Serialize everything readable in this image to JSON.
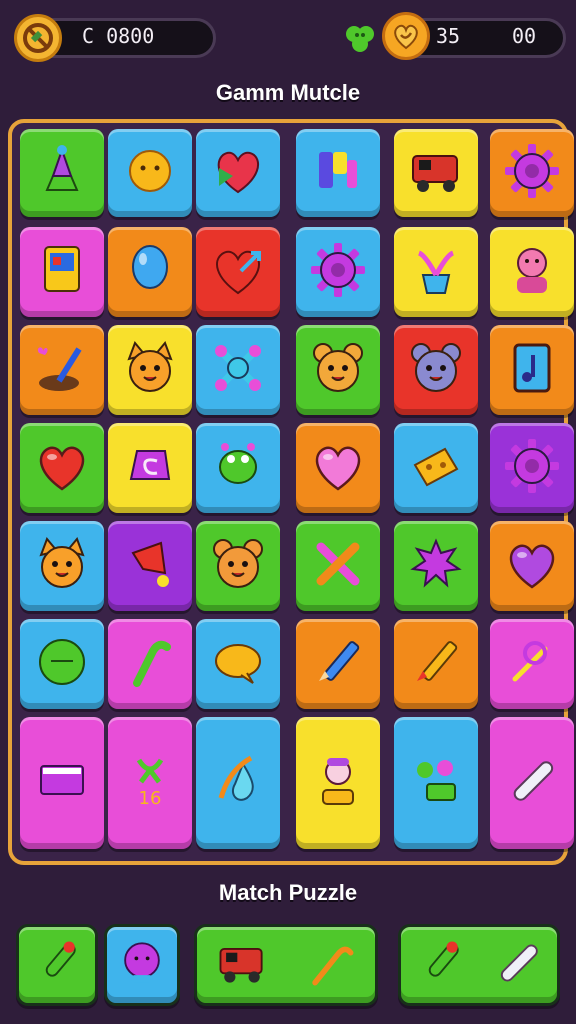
{
  "hud": {
    "score": "C 0800",
    "lives": "35",
    "timer": "00",
    "coin_icon": "no-coin-icon",
    "clover_icon": "clover-icon",
    "heart_icon": "heart-ring-icon"
  },
  "titles": {
    "top": "Gamm Mutcle",
    "bottom": "Match Puzzle"
  },
  "colors": {
    "green": "#4fc82b",
    "blue": "#3fb4ec",
    "yellow": "#f8e02c",
    "orange": "#f28a1a",
    "red": "#e8342a",
    "pink": "#e84ed8",
    "purple": "#9a32d8",
    "frame": "#e7a33a",
    "background": "#2f1d3a"
  },
  "board": {
    "rows": [
      [
        "green:gnome-icon",
        "blue:sun-icon",
        "blue:heart-gem-icon",
        "blue:letter-block-icon",
        "yellow:toy-truck-icon",
        "orange:gear-icon"
      ],
      [
        "pink:arcade-machine-icon",
        "orange:balloon-icon",
        "red:heart-arrow-icon",
        "blue:gear-icon",
        "yellow:flower-pot-icon",
        "yellow:pink-doll-icon"
      ],
      [
        "orange:paintbrush-icon",
        "yellow:cat-face-icon",
        "blue:bone-cross-icon",
        "green:bear-face-icon",
        "red:mouse-face-icon",
        "orange:music-card-icon"
      ],
      [
        "green:heart-icon",
        "yellow:candy-swirl-icon",
        "blue:frog-icon",
        "orange:pink-heart-icon",
        "blue:cheese-icon",
        "purple:gear-icon"
      ],
      [
        "blue:cat-face-icon",
        "purple:megaphone-icon",
        "green:teddy-bear-icon",
        "green:cross-sticks-icon",
        "green:splat-icon",
        "orange:purple-heart-icon"
      ],
      [
        "blue:green-ball-icon",
        "pink:candy-cane-icon",
        "blue:yellow-blob-icon",
        "orange:pencil-icon",
        "orange:crayon-icon",
        "pink:safety-pin-icon"
      ],
      [
        "pink:book-icon",
        "pink:ribbon-number-icon",
        "blue:water-drop-icon",
        "yellow:snowman-icon",
        "blue:cherry-tag-icon",
        "pink:bandage-icon"
      ]
    ]
  },
  "tray": [
    {
      "color": "green",
      "icons": [
        "rocket-icon"
      ]
    },
    {
      "color": "blue",
      "icons": [
        "crystal-ball-icon"
      ]
    },
    {
      "color": "green",
      "icons": [
        "toy-truck-icon",
        "cane-icon"
      ]
    },
    {
      "color": "green",
      "icons": [
        "rocket-icon",
        "bandage-icon"
      ]
    }
  ]
}
